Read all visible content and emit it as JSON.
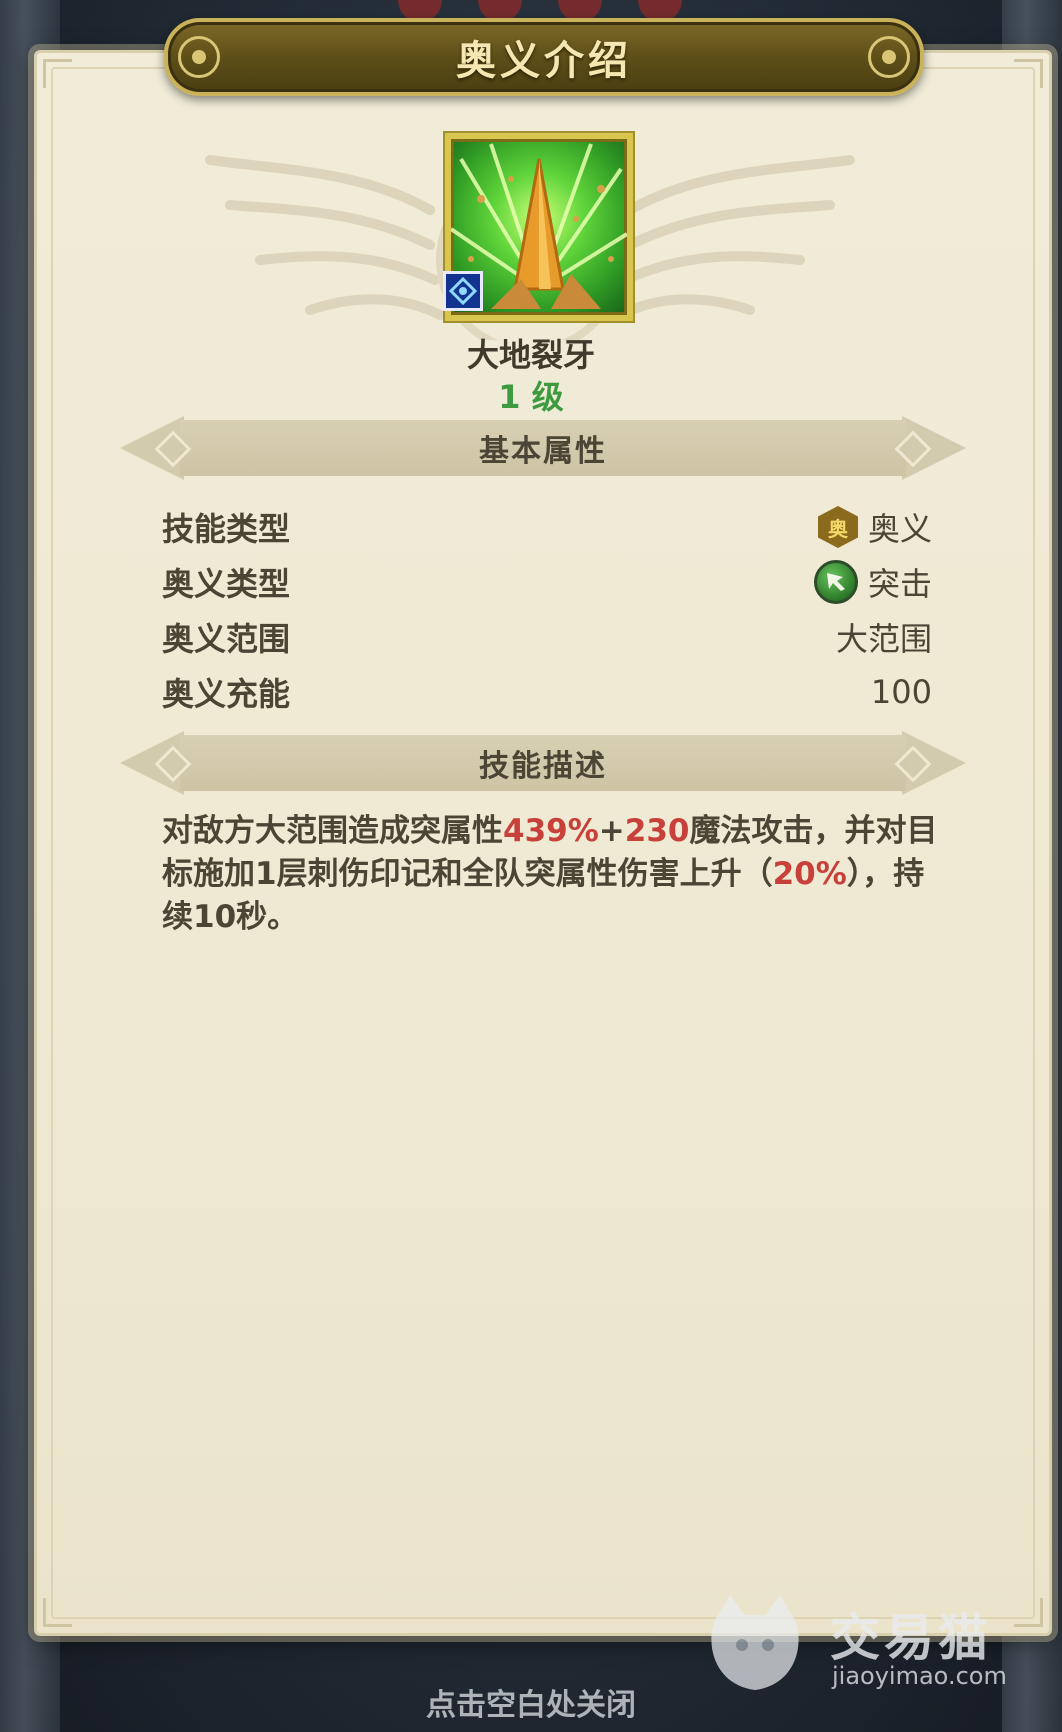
{
  "dialog": {
    "title": "奥义介绍",
    "close_hint": "点击空白处关闭"
  },
  "skill": {
    "name": "大地裂牙",
    "level": "1 级",
    "icon": "earth-fang-icon",
    "element_badge": "water-element-icon"
  },
  "sections": {
    "basic_attributes": "基本属性",
    "skill_description": "技能描述"
  },
  "attributes": [
    {
      "label": "技能类型",
      "value": "奥义",
      "icon": "ougi-hex-icon",
      "icon_text": "奥"
    },
    {
      "label": "奥义类型",
      "value": "突击",
      "icon": "assault-arrow-icon"
    },
    {
      "label": "奥义范围",
      "value": "大范围"
    },
    {
      "label": "奥义充能",
      "value": "100"
    }
  ],
  "description": {
    "part1": "对敌方大范围造成突属性",
    "hl1": "439%",
    "part2": "+",
    "hl2": "230",
    "part3": "魔法攻击，并对目标施加1层刺伤印记和全队突属性伤害上升（",
    "hl3": "20%",
    "part4": "），持续10秒。"
  },
  "watermark": {
    "brand": "交易猫",
    "url": "jiaoyimao.com"
  },
  "colors": {
    "parchment": "#efe9d3",
    "banner": "#5e4f18",
    "level_green": "#3e9a3e",
    "highlight_red": "#c8403a",
    "text_dark": "#4b4535"
  }
}
